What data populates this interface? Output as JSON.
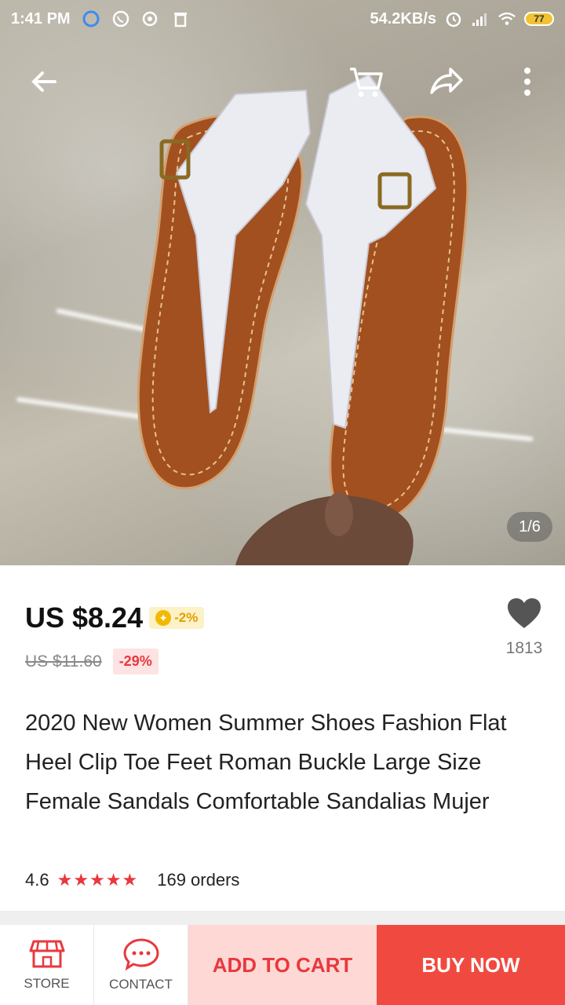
{
  "status_bar": {
    "time": "1:41 PM",
    "network_speed": "54.2KB/s",
    "battery": "77"
  },
  "hero": {
    "pager": "1/6"
  },
  "product": {
    "price": "US $8.24",
    "coin_discount": "-2%",
    "original_price": "US $11.60",
    "discount": "-29%",
    "wishlist_count": "1813",
    "title": "2020 New Women Summer Shoes Fashion Flat Heel Clip Toe Feet Roman Buckle Large Size Female Sandals Comfortable Sandalias Mujer",
    "rating": "4.6",
    "stars": "★★★★★",
    "orders": "169 orders"
  },
  "bottom_bar": {
    "store_label": "STORE",
    "contact_label": "CONTACT",
    "add_to_cart": "ADD TO CART",
    "buy_now": "BUY NOW"
  },
  "colors": {
    "accent_red": "#f04a40",
    "cart_bg": "#fdd8d5",
    "coin_gold": "#f3b900"
  },
  "icons": [
    "back-arrow-icon",
    "cart-icon",
    "share-icon",
    "more-vertical-icon",
    "heart-icon",
    "store-icon",
    "chat-icon",
    "coin-icon"
  ]
}
